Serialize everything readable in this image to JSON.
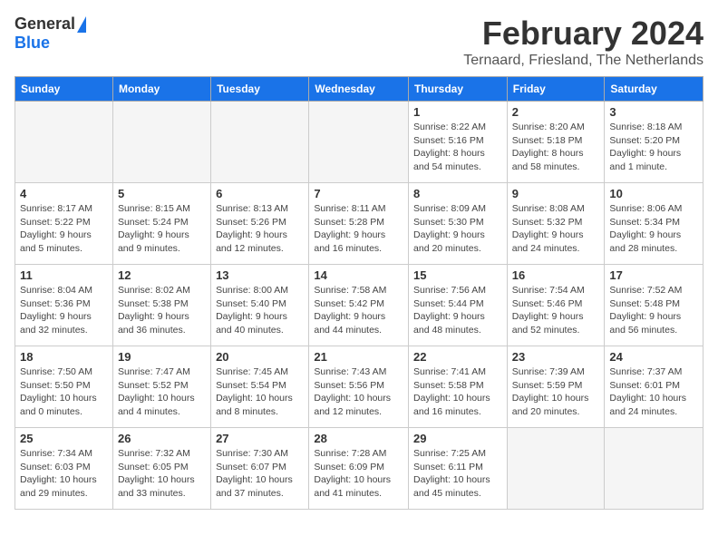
{
  "header": {
    "logo_general": "General",
    "logo_blue": "Blue",
    "month_title": "February 2024",
    "location": "Ternaard, Friesland, The Netherlands"
  },
  "weekdays": [
    "Sunday",
    "Monday",
    "Tuesday",
    "Wednesday",
    "Thursday",
    "Friday",
    "Saturday"
  ],
  "weeks": [
    [
      {
        "day": "",
        "info": ""
      },
      {
        "day": "",
        "info": ""
      },
      {
        "day": "",
        "info": ""
      },
      {
        "day": "",
        "info": ""
      },
      {
        "day": "1",
        "info": "Sunrise: 8:22 AM\nSunset: 5:16 PM\nDaylight: 8 hours\nand 54 minutes."
      },
      {
        "day": "2",
        "info": "Sunrise: 8:20 AM\nSunset: 5:18 PM\nDaylight: 8 hours\nand 58 minutes."
      },
      {
        "day": "3",
        "info": "Sunrise: 8:18 AM\nSunset: 5:20 PM\nDaylight: 9 hours\nand 1 minute."
      }
    ],
    [
      {
        "day": "4",
        "info": "Sunrise: 8:17 AM\nSunset: 5:22 PM\nDaylight: 9 hours\nand 5 minutes."
      },
      {
        "day": "5",
        "info": "Sunrise: 8:15 AM\nSunset: 5:24 PM\nDaylight: 9 hours\nand 9 minutes."
      },
      {
        "day": "6",
        "info": "Sunrise: 8:13 AM\nSunset: 5:26 PM\nDaylight: 9 hours\nand 12 minutes."
      },
      {
        "day": "7",
        "info": "Sunrise: 8:11 AM\nSunset: 5:28 PM\nDaylight: 9 hours\nand 16 minutes."
      },
      {
        "day": "8",
        "info": "Sunrise: 8:09 AM\nSunset: 5:30 PM\nDaylight: 9 hours\nand 20 minutes."
      },
      {
        "day": "9",
        "info": "Sunrise: 8:08 AM\nSunset: 5:32 PM\nDaylight: 9 hours\nand 24 minutes."
      },
      {
        "day": "10",
        "info": "Sunrise: 8:06 AM\nSunset: 5:34 PM\nDaylight: 9 hours\nand 28 minutes."
      }
    ],
    [
      {
        "day": "11",
        "info": "Sunrise: 8:04 AM\nSunset: 5:36 PM\nDaylight: 9 hours\nand 32 minutes."
      },
      {
        "day": "12",
        "info": "Sunrise: 8:02 AM\nSunset: 5:38 PM\nDaylight: 9 hours\nand 36 minutes."
      },
      {
        "day": "13",
        "info": "Sunrise: 8:00 AM\nSunset: 5:40 PM\nDaylight: 9 hours\nand 40 minutes."
      },
      {
        "day": "14",
        "info": "Sunrise: 7:58 AM\nSunset: 5:42 PM\nDaylight: 9 hours\nand 44 minutes."
      },
      {
        "day": "15",
        "info": "Sunrise: 7:56 AM\nSunset: 5:44 PM\nDaylight: 9 hours\nand 48 minutes."
      },
      {
        "day": "16",
        "info": "Sunrise: 7:54 AM\nSunset: 5:46 PM\nDaylight: 9 hours\nand 52 minutes."
      },
      {
        "day": "17",
        "info": "Sunrise: 7:52 AM\nSunset: 5:48 PM\nDaylight: 9 hours\nand 56 minutes."
      }
    ],
    [
      {
        "day": "18",
        "info": "Sunrise: 7:50 AM\nSunset: 5:50 PM\nDaylight: 10 hours\nand 0 minutes."
      },
      {
        "day": "19",
        "info": "Sunrise: 7:47 AM\nSunset: 5:52 PM\nDaylight: 10 hours\nand 4 minutes."
      },
      {
        "day": "20",
        "info": "Sunrise: 7:45 AM\nSunset: 5:54 PM\nDaylight: 10 hours\nand 8 minutes."
      },
      {
        "day": "21",
        "info": "Sunrise: 7:43 AM\nSunset: 5:56 PM\nDaylight: 10 hours\nand 12 minutes."
      },
      {
        "day": "22",
        "info": "Sunrise: 7:41 AM\nSunset: 5:58 PM\nDaylight: 10 hours\nand 16 minutes."
      },
      {
        "day": "23",
        "info": "Sunrise: 7:39 AM\nSunset: 5:59 PM\nDaylight: 10 hours\nand 20 minutes."
      },
      {
        "day": "24",
        "info": "Sunrise: 7:37 AM\nSunset: 6:01 PM\nDaylight: 10 hours\nand 24 minutes."
      }
    ],
    [
      {
        "day": "25",
        "info": "Sunrise: 7:34 AM\nSunset: 6:03 PM\nDaylight: 10 hours\nand 29 minutes."
      },
      {
        "day": "26",
        "info": "Sunrise: 7:32 AM\nSunset: 6:05 PM\nDaylight: 10 hours\nand 33 minutes."
      },
      {
        "day": "27",
        "info": "Sunrise: 7:30 AM\nSunset: 6:07 PM\nDaylight: 10 hours\nand 37 minutes."
      },
      {
        "day": "28",
        "info": "Sunrise: 7:28 AM\nSunset: 6:09 PM\nDaylight: 10 hours\nand 41 minutes."
      },
      {
        "day": "29",
        "info": "Sunrise: 7:25 AM\nSunset: 6:11 PM\nDaylight: 10 hours\nand 45 minutes."
      },
      {
        "day": "",
        "info": ""
      },
      {
        "day": "",
        "info": ""
      }
    ]
  ]
}
